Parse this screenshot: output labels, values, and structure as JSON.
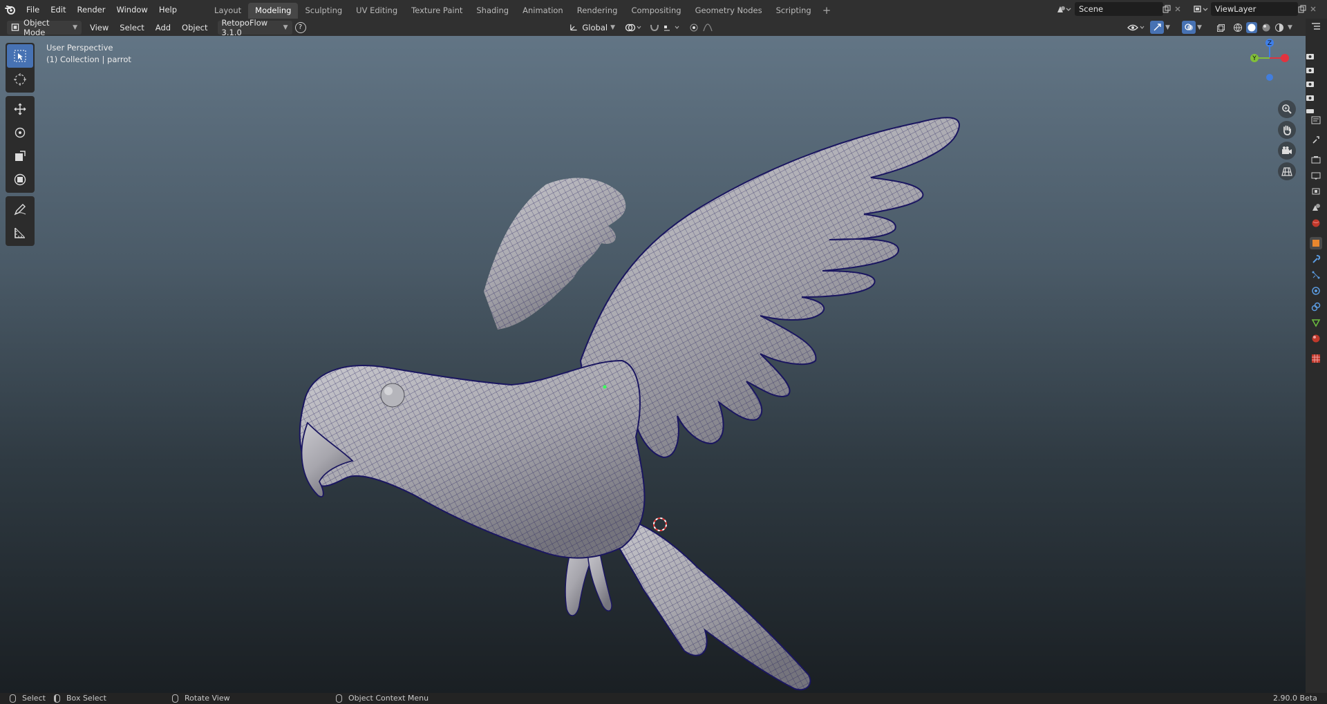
{
  "topbar": {
    "menu": [
      "File",
      "Edit",
      "Render",
      "Window",
      "Help"
    ],
    "workspaces": [
      {
        "label": "Layout",
        "active": false
      },
      {
        "label": "Modeling",
        "active": true
      },
      {
        "label": "Sculpting",
        "active": false
      },
      {
        "label": "UV Editing",
        "active": false
      },
      {
        "label": "Texture Paint",
        "active": false
      },
      {
        "label": "Shading",
        "active": false
      },
      {
        "label": "Animation",
        "active": false
      },
      {
        "label": "Rendering",
        "active": false
      },
      {
        "label": "Compositing",
        "active": false
      },
      {
        "label": "Geometry Nodes",
        "active": false
      },
      {
        "label": "Scripting",
        "active": false
      }
    ],
    "add_tab": "+",
    "scene": "Scene",
    "view_layer": "ViewLayer"
  },
  "header": {
    "mode": "Object Mode",
    "menus": [
      "View",
      "Select",
      "Add",
      "Object"
    ],
    "addon": "RetopoFlow 3.1.0",
    "help_glyph": "?",
    "orientation": "Global"
  },
  "viewport": {
    "perspective": "User Perspective",
    "collection": "(1) Collection | parrot",
    "axes": {
      "x": "X",
      "y": "Y",
      "z": "Z"
    },
    "axis_colors": {
      "x": "#e2333f",
      "y": "#82c038",
      "z": "#3f7fe8"
    }
  },
  "toolbar": {
    "tools": [
      "select-box",
      "cursor",
      "move",
      "rotate",
      "scale",
      "transform",
      "annotate",
      "measure"
    ]
  },
  "statusbar": {
    "select": "Select",
    "box_select": "Box Select",
    "rotate_view": "Rotate View",
    "context_menu": "Object Context Menu",
    "version": "2.90.0 Beta"
  },
  "colors": {
    "accent": "#4772b3",
    "wire": "#1d1a5a",
    "mesh": "#b7b6bc"
  }
}
